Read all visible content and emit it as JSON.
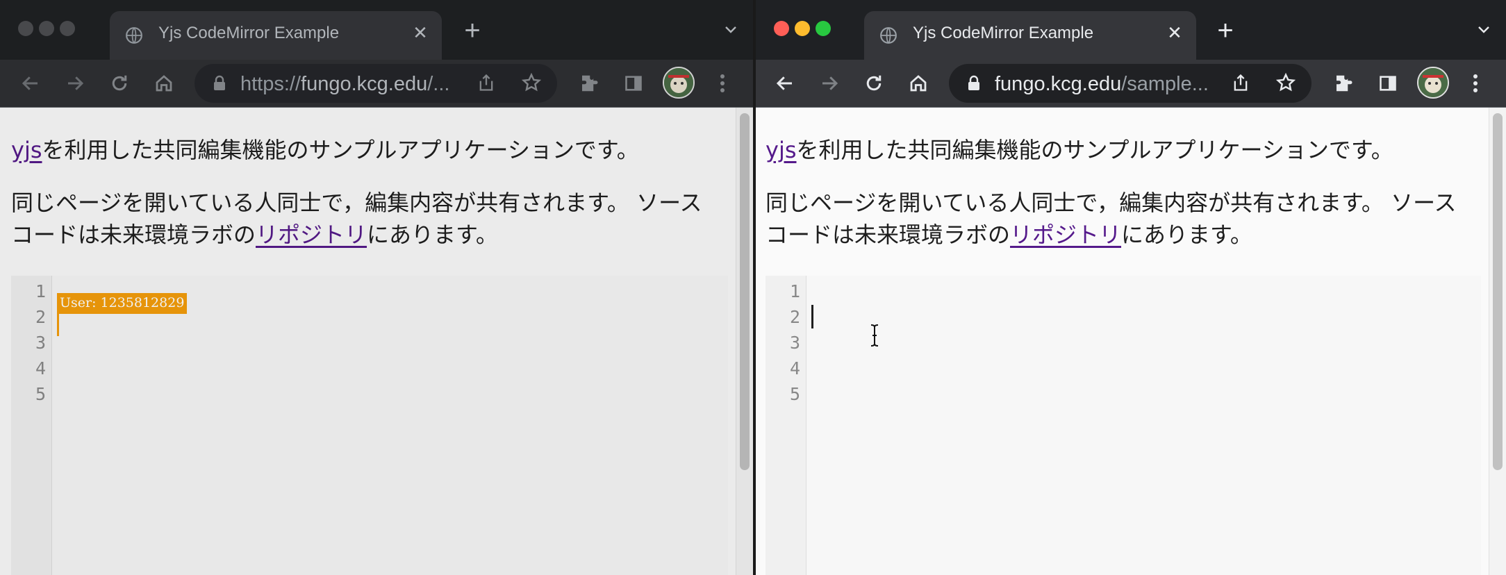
{
  "windows": {
    "left": {
      "state": "inactive",
      "tab_title": "Yjs CodeMirror Example",
      "tab_close_glyph": "✕",
      "new_tab_glyph": "+",
      "url_scheme": "https://",
      "url_host": "fungo.kcg.edu",
      "url_path": "/...",
      "caret_color": "#f59e0b",
      "remote_user_label": "User: 1235812829"
    },
    "right": {
      "state": "active",
      "tab_title": "Yjs CodeMirror Example",
      "tab_close_glyph": "✕",
      "new_tab_glyph": "+",
      "url_host": "fungo.kcg.edu",
      "url_path": "/sample...",
      "caret_color": "#1e1e1e"
    }
  },
  "page": {
    "intro_link": "yjs",
    "intro_rest": "を利用した共同編集機能のサンプルアプリケーションです。",
    "desc_before": "同じページを開いている人同士で，編集内容が共有されます。 ソースコードは未来環境ラボの",
    "desc_link": "リポジトリ",
    "desc_after": "にあります。"
  },
  "editor": {
    "line_numbers": [
      "1",
      "2",
      "3",
      "4",
      "5"
    ],
    "cursor_line": 2
  },
  "icons": {
    "traffic_lights": [
      "#ff5f57",
      "#febc2e",
      "#28c840"
    ],
    "traffic_lights_inactive": "#4d4e51"
  },
  "colors": {
    "tabstrip_bg": "#1f2124",
    "active_tab_bg": "#35363a",
    "omnibox_bg": "#202124",
    "link": "#551a8b",
    "remote_flag": "#f59e0b"
  }
}
